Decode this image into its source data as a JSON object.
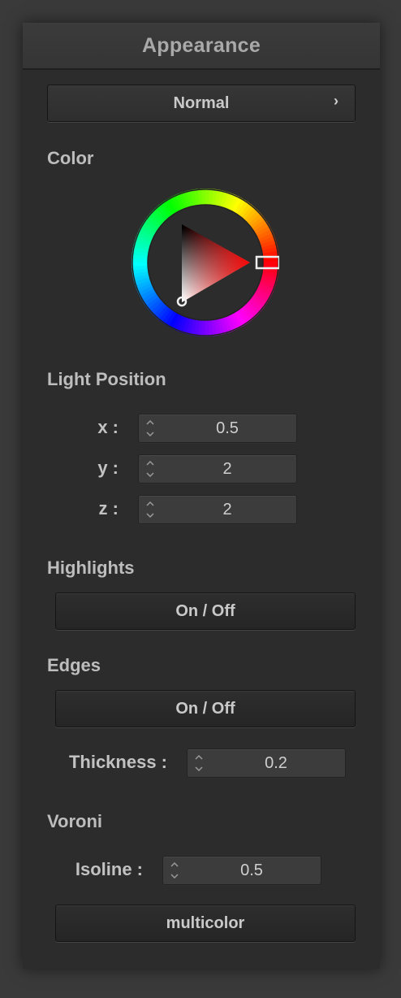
{
  "panel": {
    "title": "Appearance",
    "mode_button": {
      "label": "Normal",
      "chevron": "›"
    },
    "color": {
      "label": "Color",
      "selected_hue": "#ff0000",
      "icon": "color-wheel"
    },
    "light_position": {
      "label": "Light Position",
      "x": {
        "label": "x :",
        "value": "0.5"
      },
      "y": {
        "label": "y :",
        "value": "2"
      },
      "z": {
        "label": "z :",
        "value": "2"
      }
    },
    "highlights": {
      "label": "Highlights",
      "toggle_label": "On / Off"
    },
    "edges": {
      "label": "Edges",
      "toggle_label": "On / Off",
      "thickness": {
        "label": "Thickness :",
        "value": "0.2"
      }
    },
    "voronoi": {
      "label": "Voroni",
      "isoline": {
        "label": "Isoline :",
        "value": "0.5"
      },
      "mode_button": "multicolor"
    }
  }
}
